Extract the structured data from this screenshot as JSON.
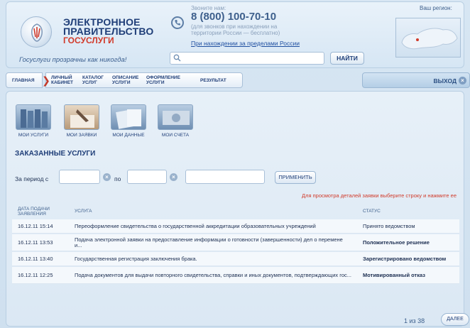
{
  "header": {
    "logo_line1": "ЭЛЕКТРОННОЕ",
    "logo_line2": "ПРАВИТЕЛЬСТВО",
    "logo_line3": "ГОСУСЛУГИ",
    "slogan": "Госуслуги прозрачны как никогда!",
    "call_label": "Звоните нам:",
    "phone": "8 (800) 100-70-10",
    "phone_note": "(для звонков при нахождении на территории России — бесплатно)",
    "abroad_link": "При нахождении за пределами России",
    "search_placeholder": "",
    "search_button": "НАЙТИ",
    "region_label": "Ваш регион:"
  },
  "breadcrumbs": {
    "items": [
      {
        "label": "ГЛАВНАЯ"
      },
      {
        "label": "ЛИЧНЫЙ КАБИНЕТ"
      },
      {
        "label": "КАТАЛОГ УСЛУГ"
      },
      {
        "label": "ОПИСАНИЕ УСЛУГИ"
      },
      {
        "label": "ОФОРМЛЕНИЕ УСЛУГИ"
      },
      {
        "label": "РЕЗУЛЬТАТ"
      }
    ],
    "exit_label": "ВЫХОД"
  },
  "tiles": [
    {
      "label": "МОИ УСЛУГИ"
    },
    {
      "label": "МОИ ЗАЯВКИ"
    },
    {
      "label": "МОИ ДАННЫЕ"
    },
    {
      "label": "МОИ СЧЕТА"
    }
  ],
  "main": {
    "section_title": "ЗАКАЗАННЫЕ УСЛУГИ",
    "period_from_label": "За период с",
    "period_to_label": "по",
    "apply_button": "ПРИМЕНИТЬ",
    "hint": "Для просмотра деталей заявки выберите строку и нажмите ее"
  },
  "table": {
    "headers": {
      "date": "ДАТА ПОДАЧИ ЗАЯВЛЕНИЯ",
      "service": "УСЛУГА",
      "status": "СТАТУС"
    },
    "rows": [
      {
        "date": "16.12.11 15:14",
        "service": "Переоформление свидетельства о государственной аккредитации образовательных учреждений",
        "status": "Принято ведомством"
      },
      {
        "date": "16.12.11 13:53",
        "service": "Подача электронной заявки на предоставление информации о готовности (завершенности) дел о перемене и...",
        "status": "Положительное решение"
      },
      {
        "date": "16.12.11 13:40",
        "service": "Государственная регистрация заключения брака.",
        "status": "Зарегистрировано ведомством"
      },
      {
        "date": "16.12.11 12:25",
        "service": "Подача документов для выдачи повторного свидетельства, справки и иных документов, подтверждающих гос...",
        "status": "Мотивированный отказ"
      }
    ]
  },
  "pager": {
    "count": "1 из 38",
    "next": "ДАЛЕЕ"
  }
}
